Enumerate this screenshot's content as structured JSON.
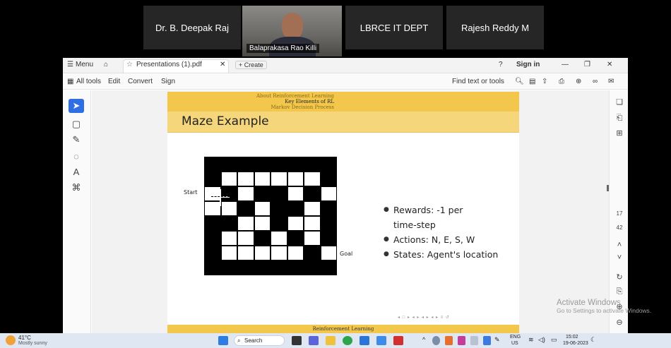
{
  "meeting": {
    "participants": [
      "Dr. B. Deepak Raj",
      "LBRCE IT DEPT",
      "Rajesh Reddy M"
    ],
    "speaker": "Balaprakasa Rao Killi"
  },
  "titlebar": {
    "menu": "Menu",
    "tab_title": "Presentations (1).pdf",
    "create": "Create",
    "sign_in": "Sign in"
  },
  "toolbar": {
    "all_tools": "All tools",
    "edit": "Edit",
    "convert": "Convert",
    "sign": "Sign",
    "find": "Find text or tools"
  },
  "slide": {
    "nav": [
      "About Reinforcement Learning",
      "Key Elements of RL",
      "Markov Decision Process"
    ],
    "title": "Maze Example",
    "start_label": "Start",
    "goal_label": "Goal",
    "bullets": [
      "Rewards: -1 per time-step",
      "Actions: N, E, S, W",
      "States: Agent's location"
    ],
    "footer": "Reinforcement Learning"
  },
  "right_panel": {
    "page": "17",
    "total": "42"
  },
  "watermark": {
    "line1": "Activate Windows",
    "line2": "Go to Settings to activate Windows."
  },
  "taskbar": {
    "temp": "41°C",
    "weather": "Mostly sunny",
    "search": "Search",
    "lang": "ENG",
    "region": "US",
    "time": "15:02",
    "date": "19-06-2023"
  },
  "colors": {
    "beamer_dark": "#f2c74c",
    "beamer_light": "#f5d67a",
    "accent": "#2f6fe4"
  }
}
